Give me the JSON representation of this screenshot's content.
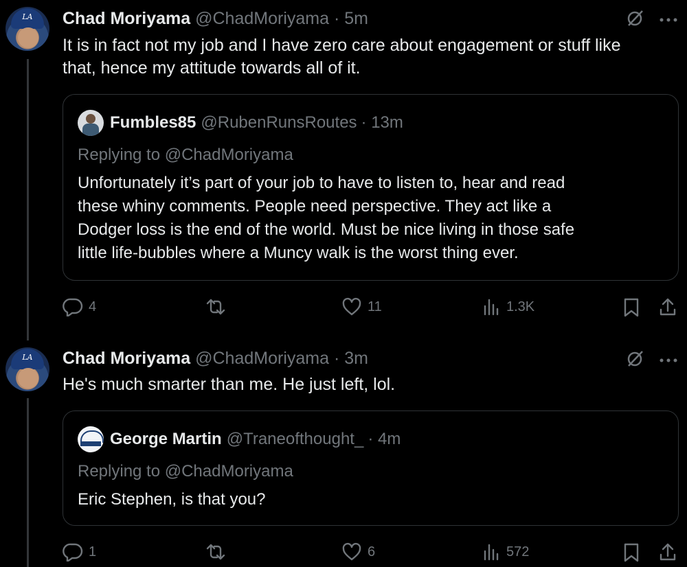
{
  "tweets": [
    {
      "author_name": "Chad Moriyama",
      "handle": "@ChadMoriyama",
      "time": "· 5m",
      "text_line1": "It is in fact not my job and I have zero care about engagement or stuff like",
      "text_line2": "that, hence my attitude towards all of it.",
      "quote": {
        "author_name": "Fumbles85",
        "handle": "@RubenRunsRoutes",
        "time": "· 13m",
        "replying_to": "Replying to @ChadMoriyama",
        "lines": [
          "Unfortunately it’s part of your job to have to listen to, hear and read",
          "these whiny comments. People need perspective. They act like a",
          "Dodger loss is the end of the world. Must be nice living in those safe",
          "little life-bubbles where a Muncy walk is the worst thing ever."
        ]
      },
      "actions": {
        "replies": "4",
        "retweets": "",
        "likes": "11",
        "views": "1.3K"
      }
    },
    {
      "author_name": "Chad Moriyama",
      "handle": "@ChadMoriyama",
      "time": "· 3m",
      "text_line1": "He's much smarter than me. He just left, lol.",
      "quote": {
        "author_name": "George Martin",
        "handle": "@Traneofthought_",
        "time": "· 4m",
        "replying_to": "Replying to @ChadMoriyama",
        "lines": [
          "Eric Stephen, is that you?"
        ]
      },
      "actions": {
        "replies": "1",
        "retweets": "",
        "likes": "6",
        "views": "572"
      }
    }
  ],
  "icons": {
    "mute": "circle-slash-icon",
    "more": "ellipsis-icon",
    "reply": "reply-icon",
    "retweet": "retweet-icon",
    "like": "heart-icon",
    "views": "views-icon",
    "bookmark": "bookmark-icon",
    "share": "share-icon"
  },
  "colors": {
    "background": "#000000",
    "text": "#e7e9ea",
    "muted": "#71767b",
    "border": "#2f3336"
  }
}
